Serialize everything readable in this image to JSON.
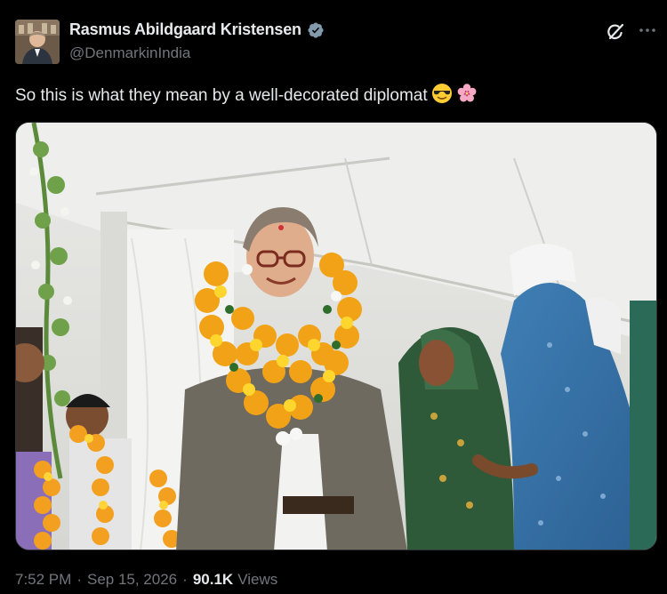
{
  "author": {
    "display_name": "Rasmus Abildgaard Kristensen",
    "handle": "@DenmarkinIndia",
    "verified": true
  },
  "tweet": {
    "text": "So this is what they mean by a well-decorated diplomat",
    "emojis": [
      "smiling-face-with-sunglasses",
      "cherry-blossom"
    ]
  },
  "meta": {
    "time": "7:52 PM",
    "date": "Sep 15, 2026",
    "views_count": "90.1K",
    "views_label": "Views",
    "separator": "·"
  },
  "colors": {
    "background": "#000000",
    "text_primary": "#e7e9ea",
    "text_secondary": "#71767b",
    "verified": "#829aab",
    "border": "#2f3336"
  },
  "icons": {
    "grok": "grok-icon",
    "more": "more-options-icon",
    "verified": "verified-badge-icon"
  }
}
